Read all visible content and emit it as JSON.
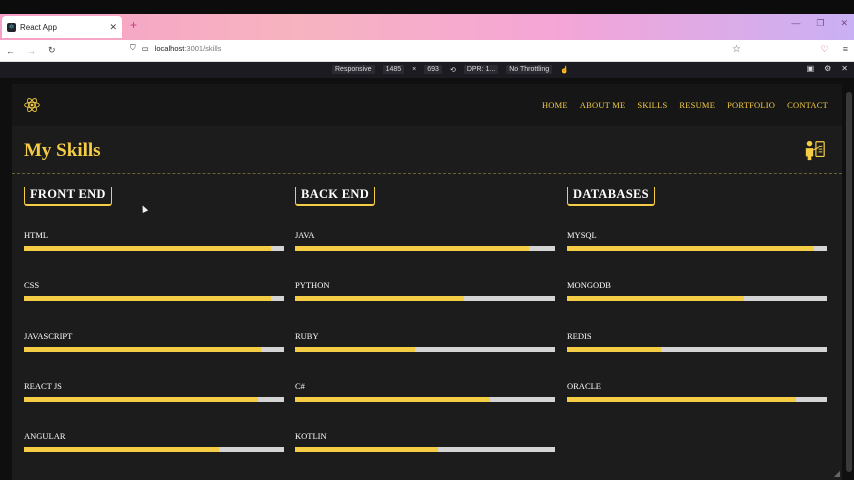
{
  "browser": {
    "tab_title": "React App",
    "new_tab": "+",
    "url_host": "localhost",
    "url_path": ":3001/skills",
    "devtools": {
      "mode": "Responsive",
      "width": "1485",
      "times": "×",
      "height": "693",
      "dpr": "DPR: 1...",
      "throttle": "No Throttling"
    }
  },
  "nav": {
    "items": [
      "HOME",
      "ABOUT ME",
      "SKILLS",
      "RESUME",
      "PORTFOLIO",
      "CONTACT"
    ]
  },
  "page": {
    "title": "My Skills"
  },
  "colors": {
    "accent": "#f5cd44",
    "track": "#d4d4d4",
    "bg": "#1c1c1c"
  },
  "columns": [
    {
      "title": "FRONT END",
      "skills": [
        {
          "name": "HTML",
          "level": 0.95
        },
        {
          "name": "CSS",
          "level": 0.95
        },
        {
          "name": "JAVASCRIPT",
          "level": 0.91
        },
        {
          "name": "REACT JS",
          "level": 0.9
        },
        {
          "name": "ANGULAR",
          "level": 0.75
        }
      ]
    },
    {
      "title": "BACK END",
      "skills": [
        {
          "name": "JAVA",
          "level": 0.9
        },
        {
          "name": "PYTHON",
          "level": 0.65
        },
        {
          "name": "RUBY",
          "level": 0.46
        },
        {
          "name": "C#",
          "level": 0.75
        },
        {
          "name": "KOTLIN",
          "level": 0.55
        }
      ]
    },
    {
      "title": "DATABASES",
      "skills": [
        {
          "name": "MYSQL",
          "level": 0.95
        },
        {
          "name": "MONGODB",
          "level": 0.68
        },
        {
          "name": "REDIS",
          "level": 0.36
        },
        {
          "name": "ORACLE",
          "level": 0.88
        }
      ]
    }
  ]
}
